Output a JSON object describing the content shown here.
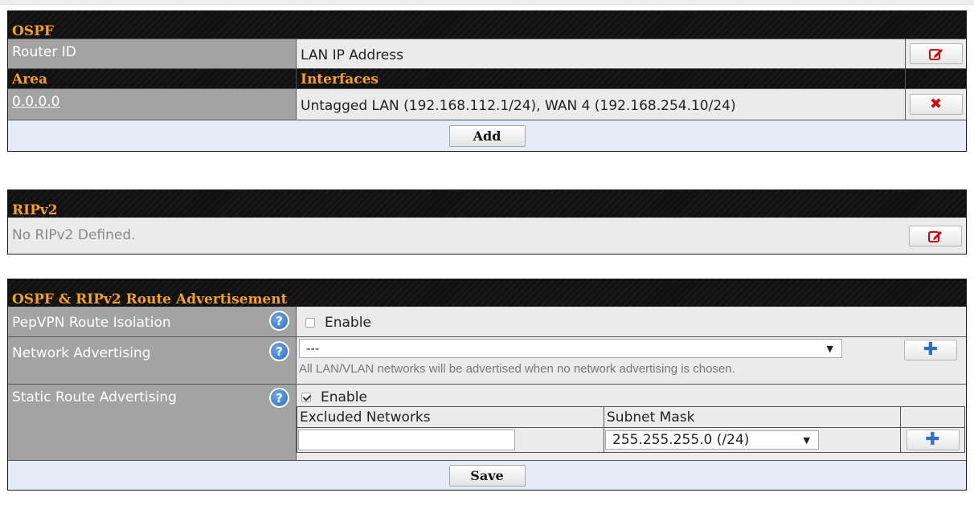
{
  "colors": {
    "header_bg": "#111111",
    "header_text": "#f7a21b",
    "label_bg": "#a3a3a3",
    "value_bg": "#ebebeb",
    "footer_bg": "#e5ecf8",
    "delete": "#d9000d",
    "add": "#2f6fc4"
  },
  "ospf": {
    "title": "OSPF",
    "router_id_label": "Router ID",
    "router_id_value": "LAN IP Address",
    "area_header": "Area",
    "interfaces_header": "Interfaces",
    "areas": [
      {
        "area": "0.0.0.0",
        "interfaces": "Untagged LAN (192.168.112.1/24), WAN 4 (192.168.254.10/24)"
      }
    ],
    "add_label": "Add",
    "edit_icon": "edit-icon",
    "delete_icon": "delete-x-icon"
  },
  "ripv2": {
    "title": "RIPv2",
    "empty_text": "No RIPv2 Defined.",
    "edit_icon": "edit-icon"
  },
  "advert": {
    "title": "OSPF & RIPv2 Route Advertisement",
    "isolation_label": "PepVPN Route Isolation",
    "isolation_enable": "Enable",
    "isolation_checked": false,
    "network_label": "Network Advertising",
    "network_selected": "---",
    "network_hint": "All LAN/VLAN networks will be advertised when no network advertising is chosen.",
    "static_label": "Static Route Advertising",
    "static_enable": "Enable",
    "static_checked": true,
    "excluded_header": "Excluded Networks",
    "mask_header": "Subnet Mask",
    "excluded_value": "",
    "mask_selected": "255.255.255.0 (/24)",
    "help_icon": "question-mark",
    "save_label": "Save"
  }
}
